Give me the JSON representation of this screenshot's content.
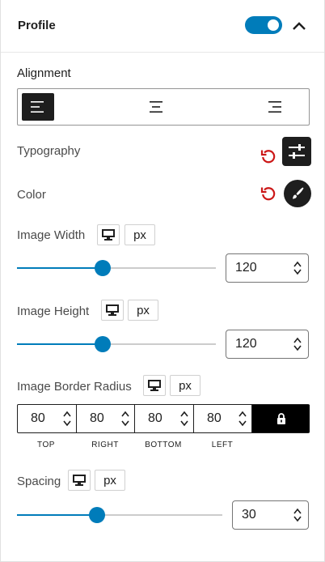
{
  "header": {
    "title": "Profile",
    "toggle_on": true
  },
  "alignment": {
    "label": "Alignment",
    "options": [
      "align-left",
      "align-center",
      "align-right"
    ],
    "selected": "align-left"
  },
  "typography": {
    "label": "Typography"
  },
  "color": {
    "label": "Color"
  },
  "image_width": {
    "label": "Image Width",
    "unit": "px",
    "value": "120",
    "slider_fraction": 0.43
  },
  "image_height": {
    "label": "Image Height",
    "unit": "px",
    "value": "120",
    "slider_fraction": 0.43
  },
  "border_radius": {
    "label": "Image Border Radius",
    "unit": "px",
    "values": {
      "top": "80",
      "right": "80",
      "bottom": "80",
      "left": "80"
    },
    "sides": {
      "top": "TOP",
      "right": "RIGHT",
      "bottom": "BOTTOM",
      "left": "LEFT"
    },
    "linked": true
  },
  "spacing": {
    "label": "Spacing",
    "unit": "px",
    "value": "30",
    "slider_fraction": 0.39
  },
  "colors": {
    "accent": "#007cba",
    "reset": "#cc1818",
    "dark": "#1e1e1e"
  }
}
